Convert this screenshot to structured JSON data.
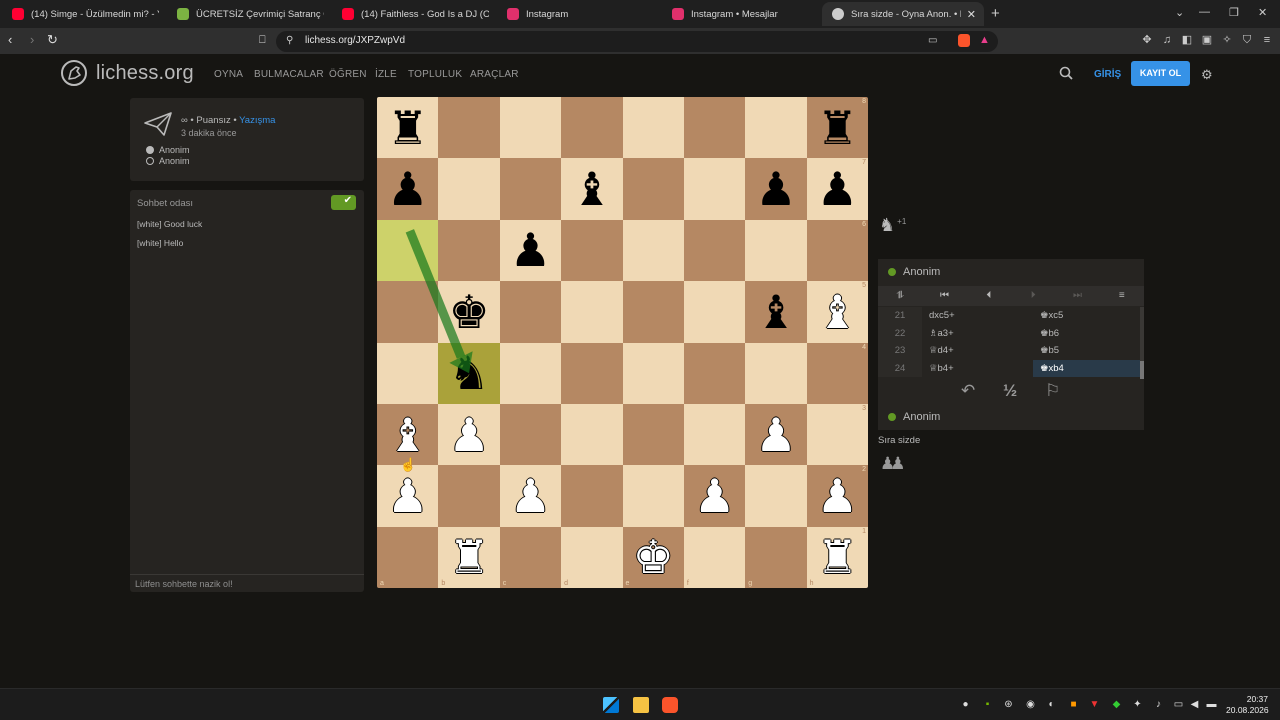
{
  "browser": {
    "tabs": [
      {
        "title": "(14) Simge - Üzülmedin mi? - Yo",
        "favicon_color": "#ff0033",
        "active": false
      },
      {
        "title": "ÜCRETSİZ Çevrimiçi Satranç Oynayın",
        "favicon_color": "#7cb342",
        "active": false
      },
      {
        "title": "(14) Faithless - God Is a DJ (Official V",
        "favicon_color": "#ff0033",
        "active": false
      },
      {
        "title": "Instagram",
        "favicon_color": "#e1306c",
        "active": false
      },
      {
        "title": "Instagram • Mesajlar",
        "favicon_color": "#e1306c",
        "active": false
      },
      {
        "title": "Sıra sizde - Oyna Anon. • lich",
        "favicon_color": "#cccccc",
        "active": true
      }
    ],
    "url": "lichess.org/JXPZwpVd"
  },
  "site": {
    "logo_text": "lichess.org",
    "nav": [
      "OYNA",
      "BULMACALAR",
      "ÖĞREN",
      "İZLE",
      "TOPLULUK",
      "ARAÇLAR"
    ],
    "login": "GİRİŞ",
    "signup": "KAYIT OL"
  },
  "game_info": {
    "infinity": "∞",
    "sep1": " • Puansız • ",
    "mode": "Yazışma",
    "time_ago": "3 dakika önce",
    "white_player": "Anonim",
    "black_player": "Anonim"
  },
  "chat": {
    "title": "Sohbet odası",
    "messages": [
      "[white] Good luck",
      "[white] Hello"
    ],
    "placeholder": "Lütfen sohbette nazik ol!"
  },
  "board": {
    "files": [
      "a",
      "b",
      "c",
      "d",
      "e",
      "f",
      "g",
      "h"
    ],
    "ranks": [
      "8",
      "7",
      "6",
      "5",
      "4",
      "3",
      "2",
      "1"
    ],
    "rows": [
      [
        "bR",
        "",
        "",
        "",
        "",
        "",
        "",
        "bR"
      ],
      [
        "bP",
        "",
        "",
        "bB",
        "",
        "",
        "bP",
        "bP"
      ],
      [
        "",
        "",
        "bP",
        "",
        "",
        "",
        "",
        ""
      ],
      [
        "",
        "bK",
        "",
        "",
        "",
        "",
        "bB",
        "wB"
      ],
      [
        "",
        "bN",
        "",
        "",
        "",
        "",
        "",
        ""
      ],
      [
        "wB",
        "wP",
        "",
        "",
        "",
        "",
        "wP",
        ""
      ],
      [
        "wP",
        "",
        "wP",
        "",
        "",
        "wP",
        "",
        "wP"
      ],
      [
        "",
        "wR",
        "",
        "",
        "wK",
        "",
        "",
        "wR"
      ]
    ],
    "highlight_squares": [
      "a6",
      "b4"
    ],
    "arrow": {
      "from": "a6",
      "to": "b4",
      "color": "#15781b"
    }
  },
  "right_panel": {
    "captured_piece": "♞",
    "captured_diff": "+1",
    "top_player": "Anonim",
    "bottom_player": "Anonim",
    "moves": [
      {
        "num": "21",
        "white": "dxc5+",
        "black": "♚xc5"
      },
      {
        "num": "22",
        "white": "♗a3+",
        "black": "♚b6"
      },
      {
        "num": "23",
        "white": "♕d4+",
        "black": "♚b5"
      },
      {
        "num": "24",
        "white": "♕b4+",
        "black": "♚xb4"
      }
    ],
    "current_move": "♚xb4",
    "draw_label": "½",
    "turn_text": "Sıra sizde"
  },
  "taskbar": {
    "time": "20:37",
    "date": "20.08.2026"
  }
}
